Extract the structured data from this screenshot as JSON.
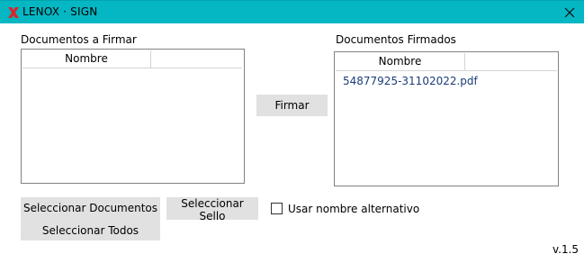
{
  "window": {
    "title": "LENOX · SIGN",
    "logo_icon": "lenox-x-logo",
    "close_icon": "close-icon",
    "accent_color": "#05b6c3"
  },
  "left_panel": {
    "label": "Documentos a Firmar",
    "column_header": "Nombre",
    "items": []
  },
  "right_panel": {
    "label": "Documentos Firmados",
    "column_header": "Nombre",
    "items": [
      "54877925-31102022.pdf"
    ]
  },
  "buttons": {
    "sign": "Firmar",
    "select_documents": "Seleccionar Documentos",
    "select_all": "Seleccionar Todos",
    "select_seal": "Seleccionar Sello"
  },
  "options": {
    "alt_name_label": "Usar nombre alternativo",
    "alt_name_checked": false
  },
  "version": "v.1.5"
}
